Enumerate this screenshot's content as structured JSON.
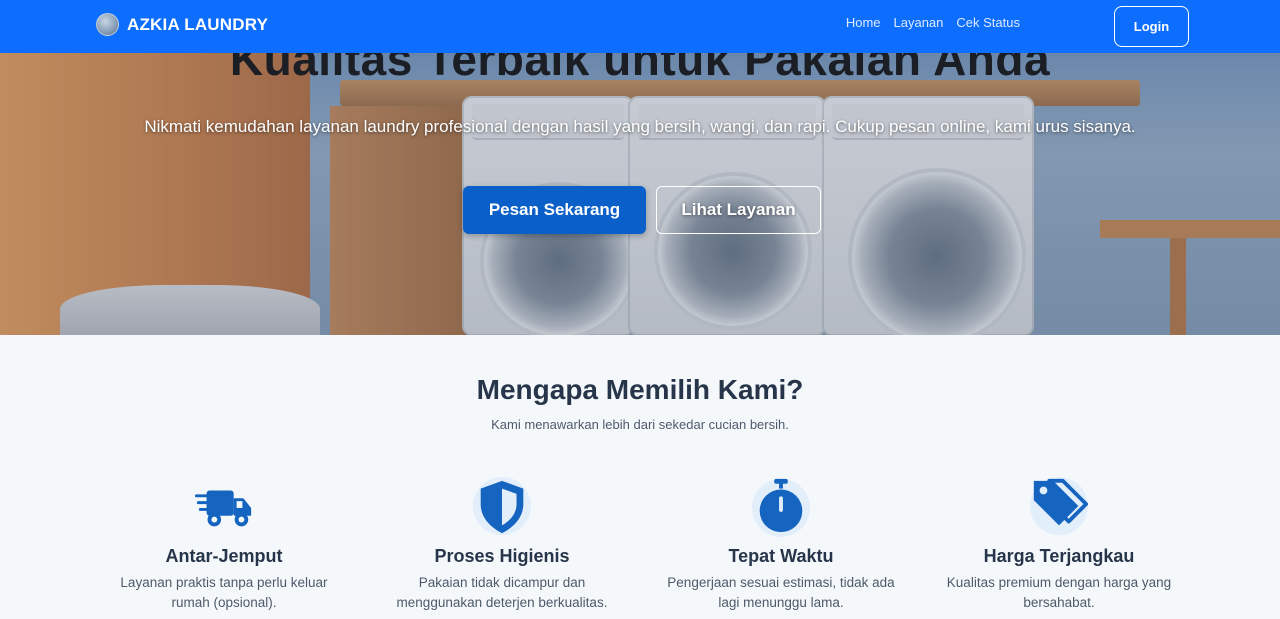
{
  "brand": {
    "name": "AZKIA LAUNDRY",
    "primary_color": "#0d6efd",
    "dark_button_color": "#0b5fc9"
  },
  "nav": {
    "links": [
      "Home",
      "Layanan",
      "Cek Status"
    ],
    "login_label": "Login"
  },
  "hero": {
    "title": "Kualitas Terbaik untuk Pakaian Anda",
    "subtitle": "Nikmati kemudahan layanan laundry profesional dengan hasil yang bersih, wangi, dan rapi. Cukup pesan online, kami urus sisanya.",
    "primary_button": "Pesan Sekarang",
    "secondary_button": "Lihat Layanan"
  },
  "features": {
    "title": "Mengapa Memilih Kami?",
    "subtitle": "Kami menawarkan lebih dari sekedar cucian bersih.",
    "items": [
      {
        "icon": "truck-icon",
        "title": "Antar-Jemput",
        "desc": "Layanan praktis tanpa perlu keluar rumah (opsional)."
      },
      {
        "icon": "shield-icon",
        "title": "Proses Higienis",
        "desc": "Pakaian tidak dicampur dan menggunakan deterjen berkualitas."
      },
      {
        "icon": "stopwatch-icon",
        "title": "Tepat Waktu",
        "desc": "Pengerjaan sesuai estimasi, tidak ada lagi menunggu lama."
      },
      {
        "icon": "tags-icon",
        "title": "Harga Terjangkau",
        "desc": "Kualitas premium dengan harga yang bersahabat."
      }
    ],
    "icon_color": "#1565c0"
  }
}
